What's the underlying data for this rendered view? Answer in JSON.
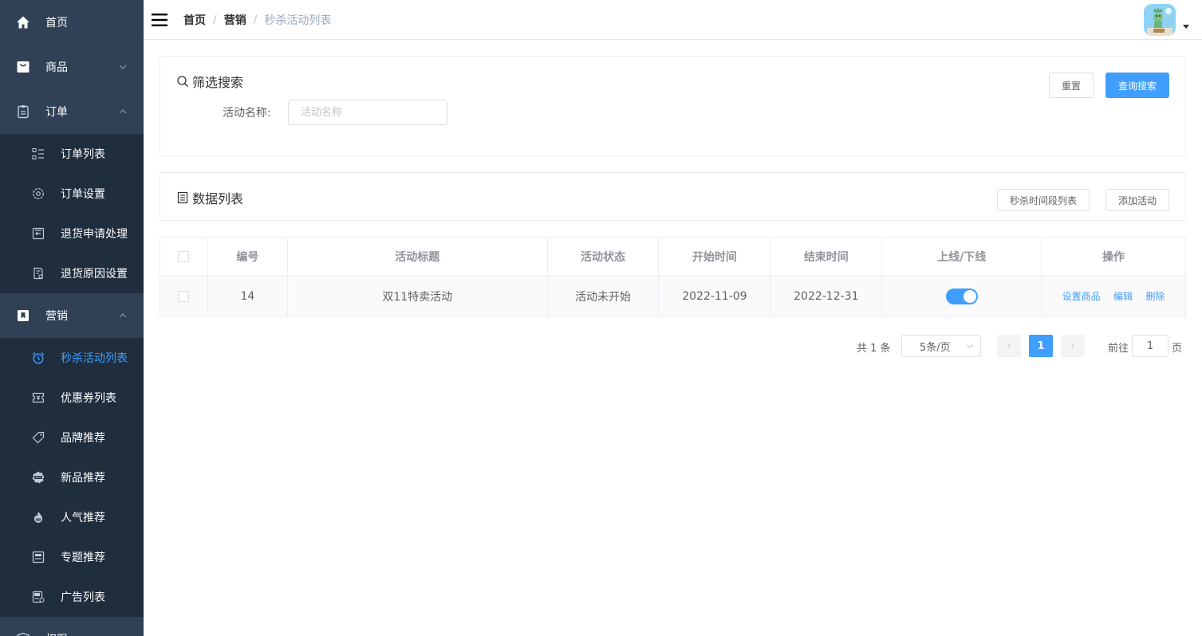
{
  "sidebar": {
    "items": [
      {
        "label": "首页",
        "icon": "home-icon"
      },
      {
        "label": "商品",
        "icon": "shopping-bag-icon"
      },
      {
        "label": "订单",
        "icon": "clipboard-icon"
      },
      {
        "label": "营销",
        "icon": "bookmark-icon"
      },
      {
        "label": "权限",
        "icon": "shield-icon"
      }
    ],
    "order_sub": [
      {
        "label": "订单列表",
        "icon": "list-icon"
      },
      {
        "label": "订单设置",
        "icon": "settings-icon"
      },
      {
        "label": "退货申请处理",
        "icon": "return-icon"
      },
      {
        "label": "退货原因设置",
        "icon": "doc-settings-icon"
      }
    ],
    "marketing_sub": [
      {
        "label": "秒杀活动列表",
        "icon": "alarm-clock-icon"
      },
      {
        "label": "优惠券列表",
        "icon": "coupon-icon"
      },
      {
        "label": "品牌推荐",
        "icon": "tag-icon"
      },
      {
        "label": "新品推荐",
        "icon": "new-badge-icon"
      },
      {
        "label": "人气推荐",
        "icon": "hot-flame-icon"
      },
      {
        "label": "专题推荐",
        "icon": "topic-icon"
      },
      {
        "label": "广告列表",
        "icon": "ad-icon"
      }
    ],
    "bg_color": "#304156",
    "submenu_bg": "#1f2d3d",
    "active_color": "#409eff"
  },
  "topbar": {
    "breadcrumb": [
      "首页",
      "营销",
      "秒杀活动列表"
    ],
    "separator": "/"
  },
  "filter": {
    "title": "筛选搜索",
    "reset_label": "重置",
    "search_label": "查询搜索",
    "field_label": "活动名称:",
    "field_placeholder": "活动名称",
    "field_value": ""
  },
  "list": {
    "title": "数据列表",
    "timeslot_label": "秒杀时间段列表",
    "add_label": "添加活动"
  },
  "table": {
    "headers": [
      "编号",
      "活动标题",
      "活动状态",
      "开始时间",
      "结束时间",
      "上线/下线",
      "操作"
    ],
    "rows": [
      {
        "id": "14",
        "title": "双11特卖活动",
        "status": "活动未开始",
        "start": "2022-11-09",
        "end": "2022-12-31",
        "online": true,
        "actions": [
          "设置商品",
          "编辑",
          "删除"
        ]
      }
    ]
  },
  "pagination": {
    "total": "共 1 条",
    "page_size": "5条/页",
    "prev": "‹",
    "next": "›",
    "current": "1",
    "goto_label": "前往",
    "goto_value": "1",
    "page_unit": "页"
  },
  "colors": {
    "primary": "#409eff",
    "border": "#ebeef5"
  }
}
